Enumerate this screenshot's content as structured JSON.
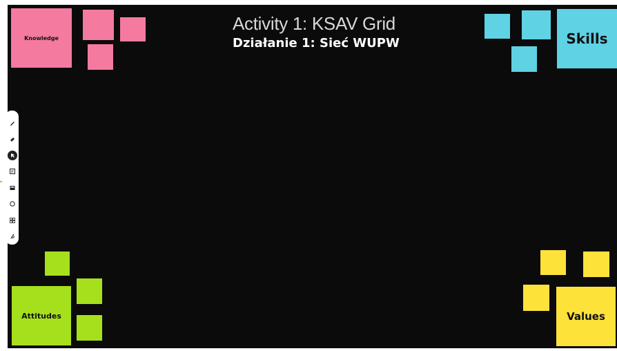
{
  "board": {
    "title": "Activity 1: KSAV Grid",
    "subtitle": "Działanie 1: Sieć WUPW"
  },
  "corners": {
    "knowledge": {
      "label": "Knowledge",
      "color": "#f47aa0"
    },
    "skills": {
      "label": "Skills",
      "color": "#5fd2e4"
    },
    "attitudes": {
      "label": "Attitudes",
      "color": "#a6e01c"
    },
    "values": {
      "label": "Values",
      "color": "#fde23a"
    }
  },
  "toolbar": {
    "tools": [
      "pen-icon",
      "marker-icon",
      "select-icon",
      "sticky-note-icon",
      "card-icon",
      "shape-icon",
      "grid-icon",
      "more-icon"
    ],
    "active_tool": "select-icon"
  }
}
